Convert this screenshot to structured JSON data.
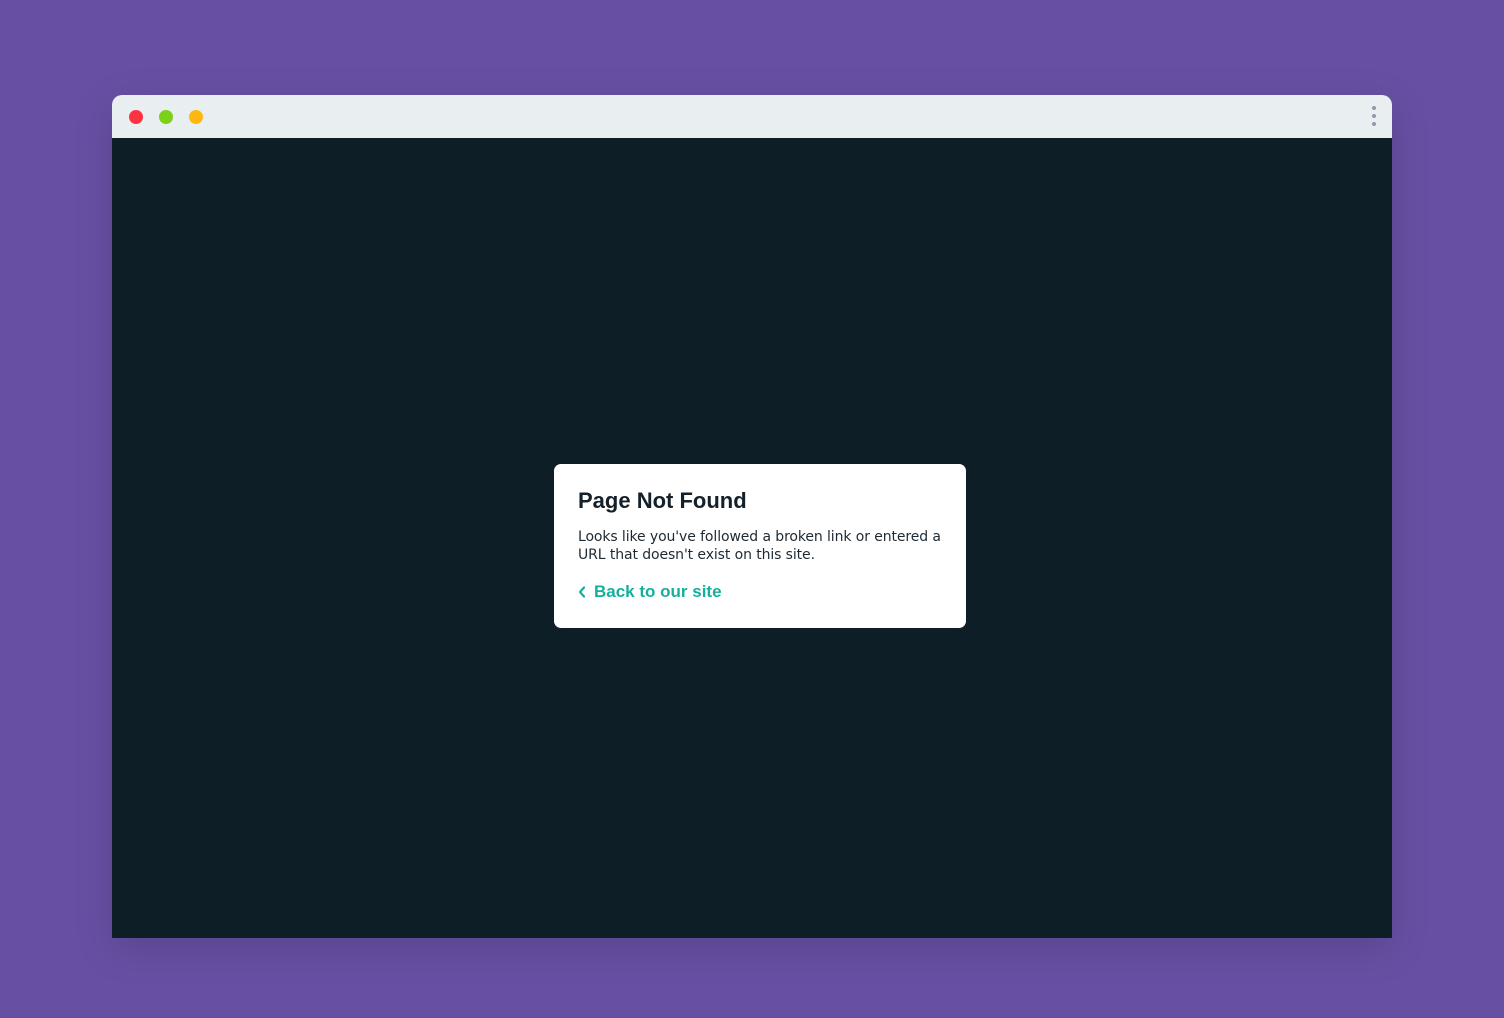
{
  "window": {
    "controls": {
      "close_color": "#fc3340",
      "zoom_color": "#7bd01a",
      "minimize_color": "#fdb70f"
    },
    "menu_icon": "kebab-menu-icon"
  },
  "page": {
    "background": "#0e1e26",
    "dialog": {
      "title": "Page Not Found",
      "message": "Looks like you've followed a broken link or entered a URL that doesn't exist on this site.",
      "back_link": {
        "icon": "chevron-left-icon",
        "label": "Back to our site",
        "color": "#14b09c"
      }
    }
  }
}
